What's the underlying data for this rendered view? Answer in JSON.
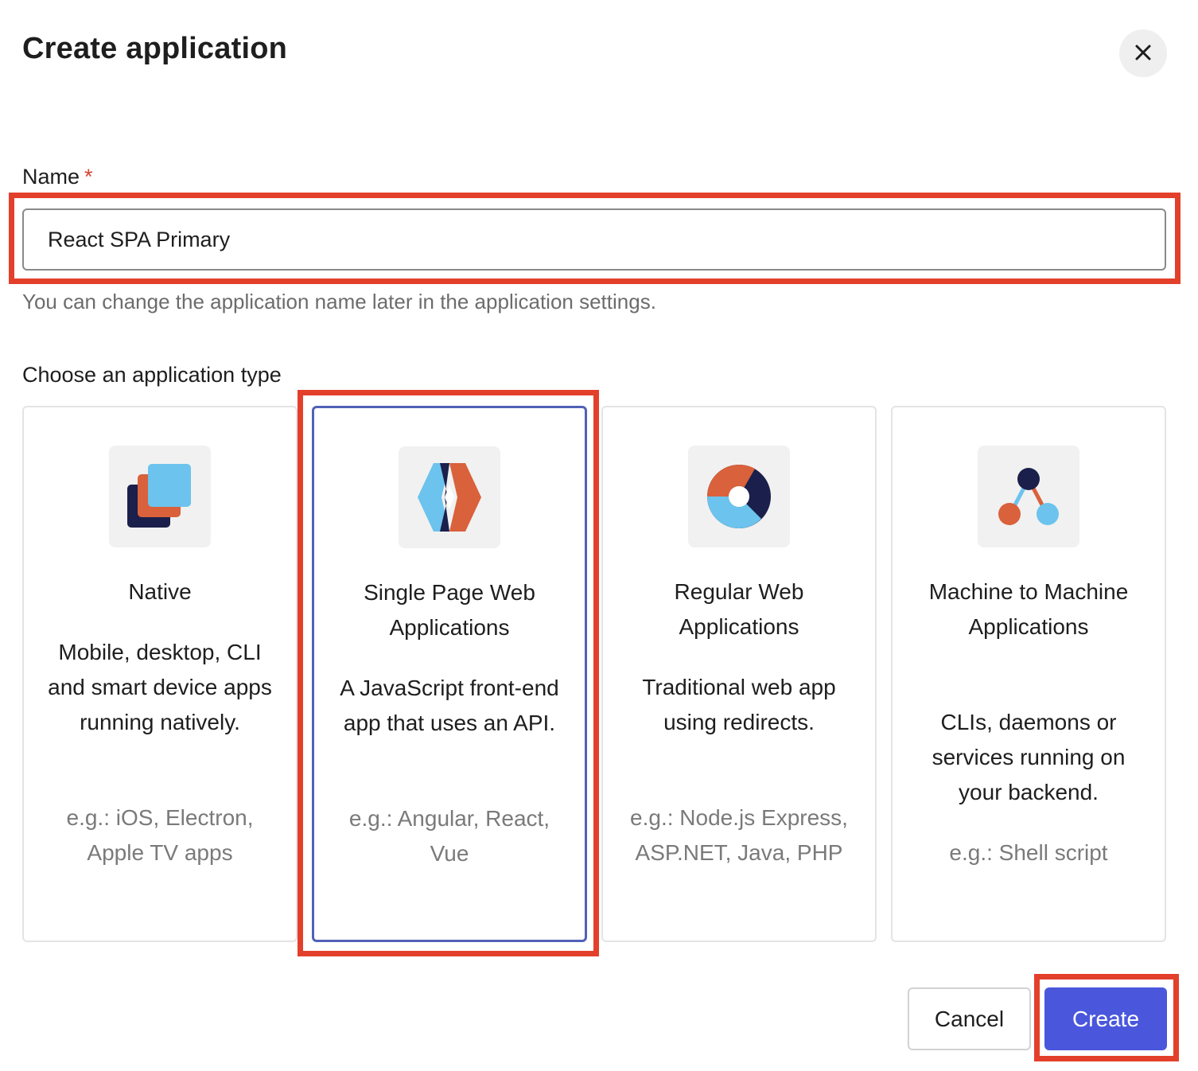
{
  "dialog": {
    "title": "Create application",
    "close_icon": "close-icon"
  },
  "name_field": {
    "label": "Name",
    "required_mark": "*",
    "value": "React SPA Primary",
    "helper": "You can change the application name later in the application settings."
  },
  "app_type": {
    "label": "Choose an application type",
    "selected": "Single Page Web Applications",
    "cards": [
      {
        "icon": "native-stack-icon",
        "title": "Native",
        "description": "Mobile, desktop, CLI and smart device apps running natively.",
        "example": "e.g.: iOS, Electron, Apple TV apps"
      },
      {
        "icon": "spa-diamond-icon",
        "title": "Single Page Web Applications",
        "description": "A JavaScript front-end app that uses an API.",
        "example": "e.g.: Angular, React, Vue"
      },
      {
        "icon": "regular-web-donut-icon",
        "title": "Regular Web Applications",
        "description": "Traditional web app using redirects.",
        "example": "e.g.: Node.js Express, ASP.NET, Java, PHP"
      },
      {
        "icon": "machine-nodes-icon",
        "title": "Machine to Machine Applications",
        "description": "CLIs, daemons or services running on your backend.",
        "example": "e.g.: Shell script"
      }
    ]
  },
  "footer": {
    "cancel_label": "Cancel",
    "create_label": "Create"
  },
  "colors": {
    "highlight": "#e3402b",
    "primary": "#4a57dc",
    "selected_border": "#5061b6",
    "navy": "#1b1f4b",
    "orange": "#d9613b",
    "light_blue": "#6cc3ed"
  }
}
